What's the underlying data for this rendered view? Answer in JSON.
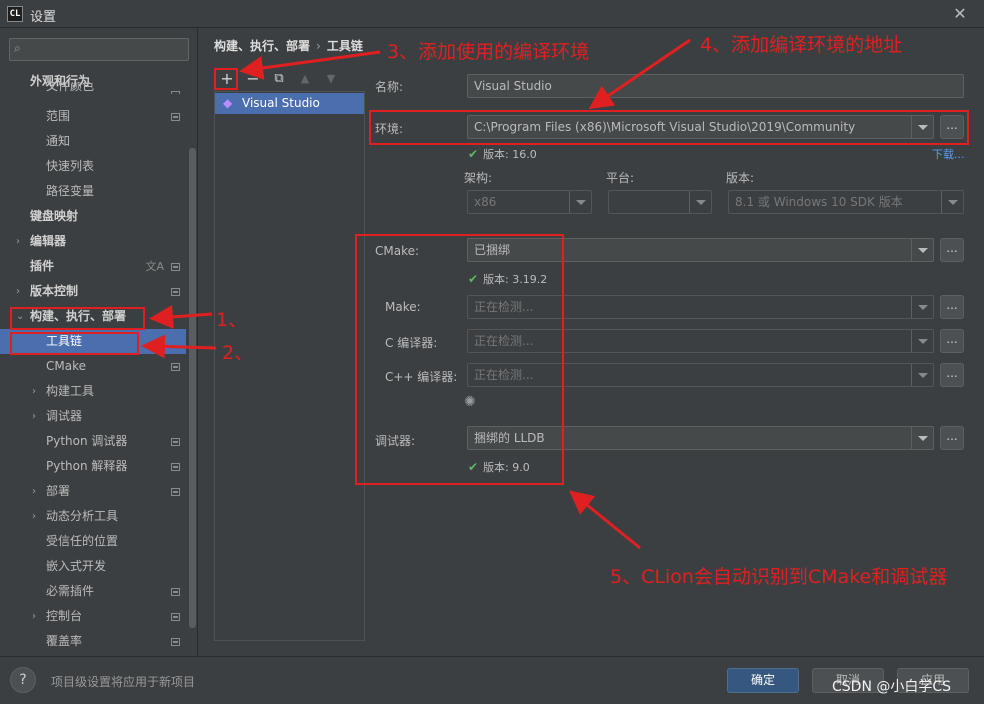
{
  "window": {
    "title": "设置",
    "app_logo": "CL",
    "close_glyph": "✕"
  },
  "search": {
    "value": "",
    "icon": "search-icon"
  },
  "sidebar": {
    "items": [
      {
        "label": "外观和行为",
        "bold": true
      },
      {
        "label": "文件颜色",
        "badge": true
      },
      {
        "label": "范围",
        "badge": true
      },
      {
        "label": "通知"
      },
      {
        "label": "快速列表"
      },
      {
        "label": "路径变量"
      },
      {
        "label": "键盘映射",
        "bold": true
      },
      {
        "label": "编辑器",
        "bold": true,
        "chevron": "›"
      },
      {
        "label": "插件",
        "bold": true,
        "badge": true,
        "translate_icon": "文A"
      },
      {
        "label": "版本控制",
        "bold": true,
        "chevron": "›",
        "badge": true
      },
      {
        "label": "构建、执行、部署",
        "bold": true,
        "chevron": "⌄"
      },
      {
        "label": "工具链",
        "selected": true
      },
      {
        "label": "CMake",
        "badge": true
      },
      {
        "label": "构建工具",
        "chevron": "›"
      },
      {
        "label": "调试器",
        "chevron": "›"
      },
      {
        "label": "Python 调试器",
        "badge": true
      },
      {
        "label": "Python 解释器",
        "badge": true
      },
      {
        "label": "部署",
        "chevron": "›",
        "badge": true
      },
      {
        "label": "动态分析工具",
        "chevron": "›"
      },
      {
        "label": "受信任的位置"
      },
      {
        "label": "嵌入式开发"
      },
      {
        "label": "必需插件",
        "badge": true
      },
      {
        "label": "控制台",
        "chevron": "›",
        "badge": true
      },
      {
        "label": "覆盖率",
        "badge": true
      }
    ]
  },
  "breadcrumb": {
    "parent": "构建、执行、部署",
    "separator": "›",
    "current": "工具链"
  },
  "toolbar": {
    "add": "+",
    "remove": "−",
    "copy": "⧉",
    "up": "▲",
    "down": "▼"
  },
  "toolchains": [
    {
      "label": "Visual Studio"
    }
  ],
  "form": {
    "name_label": "名称:",
    "name_value": "Visual Studio",
    "env_label": "环境:",
    "env_value": "C:\\Program Files (x86)\\Microsoft Visual Studio\\2019\\Community",
    "env_version": "版本: 16.0",
    "download_link": "下载...",
    "arch_label": "架构:",
    "arch_value": "x86",
    "platform_label": "平台:",
    "platform_value": "",
    "sdk_label": "版本:",
    "sdk_value": "8.1 或 Windows 10 SDK 版本",
    "cmake_label": "CMake:",
    "cmake_value": "已捆绑",
    "cmake_version": "版本: 3.19.2",
    "make_label": "Make:",
    "make_placeholder": "正在检测...",
    "c_label": "C 编译器:",
    "c_placeholder": "正在检测...",
    "cpp_label": "C++ 编译器:",
    "cpp_placeholder": "正在检测...",
    "debugger_label": "调试器:",
    "debugger_value": "捆绑的 LLDB",
    "debugger_version": "版本: 9.0",
    "browse": "...",
    "check": "✔",
    "spinner": "✺"
  },
  "annotations": {
    "a1": "1、",
    "a2": "2、",
    "a3": "3、添加使用的编译环境",
    "a4": "4、添加编译环境的地址",
    "a5": "5、CLion会自动识别到CMake和调试器",
    "color": "#e02020"
  },
  "footer": {
    "help": "?",
    "note": "项目级设置将应用于新项目",
    "ok": "确定",
    "cancel": "取消",
    "apply": "应用",
    "watermark": "CSDN @小白学CS"
  }
}
